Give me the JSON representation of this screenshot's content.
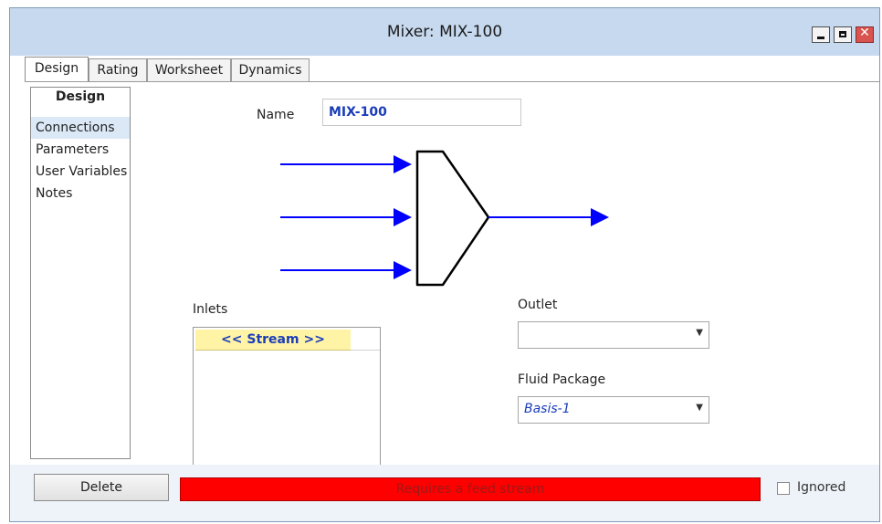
{
  "window": {
    "title": "Mixer: MIX-100",
    "controls": [
      "minimize",
      "maximize",
      "close"
    ]
  },
  "tabs": [
    {
      "label": "Design",
      "active": true
    },
    {
      "label": "Rating",
      "active": false
    },
    {
      "label": "Worksheet",
      "active": false
    },
    {
      "label": "Dynamics",
      "active": false
    }
  ],
  "left_panel": {
    "header": "Design",
    "items": [
      {
        "label": "Connections",
        "selected": true
      },
      {
        "label": "Parameters",
        "selected": false
      },
      {
        "label": "User Variables",
        "selected": false
      },
      {
        "label": "Notes",
        "selected": false
      }
    ]
  },
  "form": {
    "name_label": "Name",
    "name_value": "MIX-100",
    "inlets_label": "Inlets",
    "stream_cell": "<< Stream >>",
    "outlet_label": "Outlet",
    "outlet_value": "",
    "fluid_package_label": "Fluid Package",
    "fluid_package_value": "Basis-1"
  },
  "footer": {
    "delete_label": "Delete",
    "status_text": "Requires a feed stream",
    "ignored_label": "Ignored",
    "ignored_checked": false
  },
  "colors": {
    "titlebar": "#c6d9ef",
    "accent_text": "#1a3db8",
    "status_error": "#ff0000",
    "stream_arrow": "#0000ff",
    "stream_cell_bg": "#fff3a6"
  }
}
